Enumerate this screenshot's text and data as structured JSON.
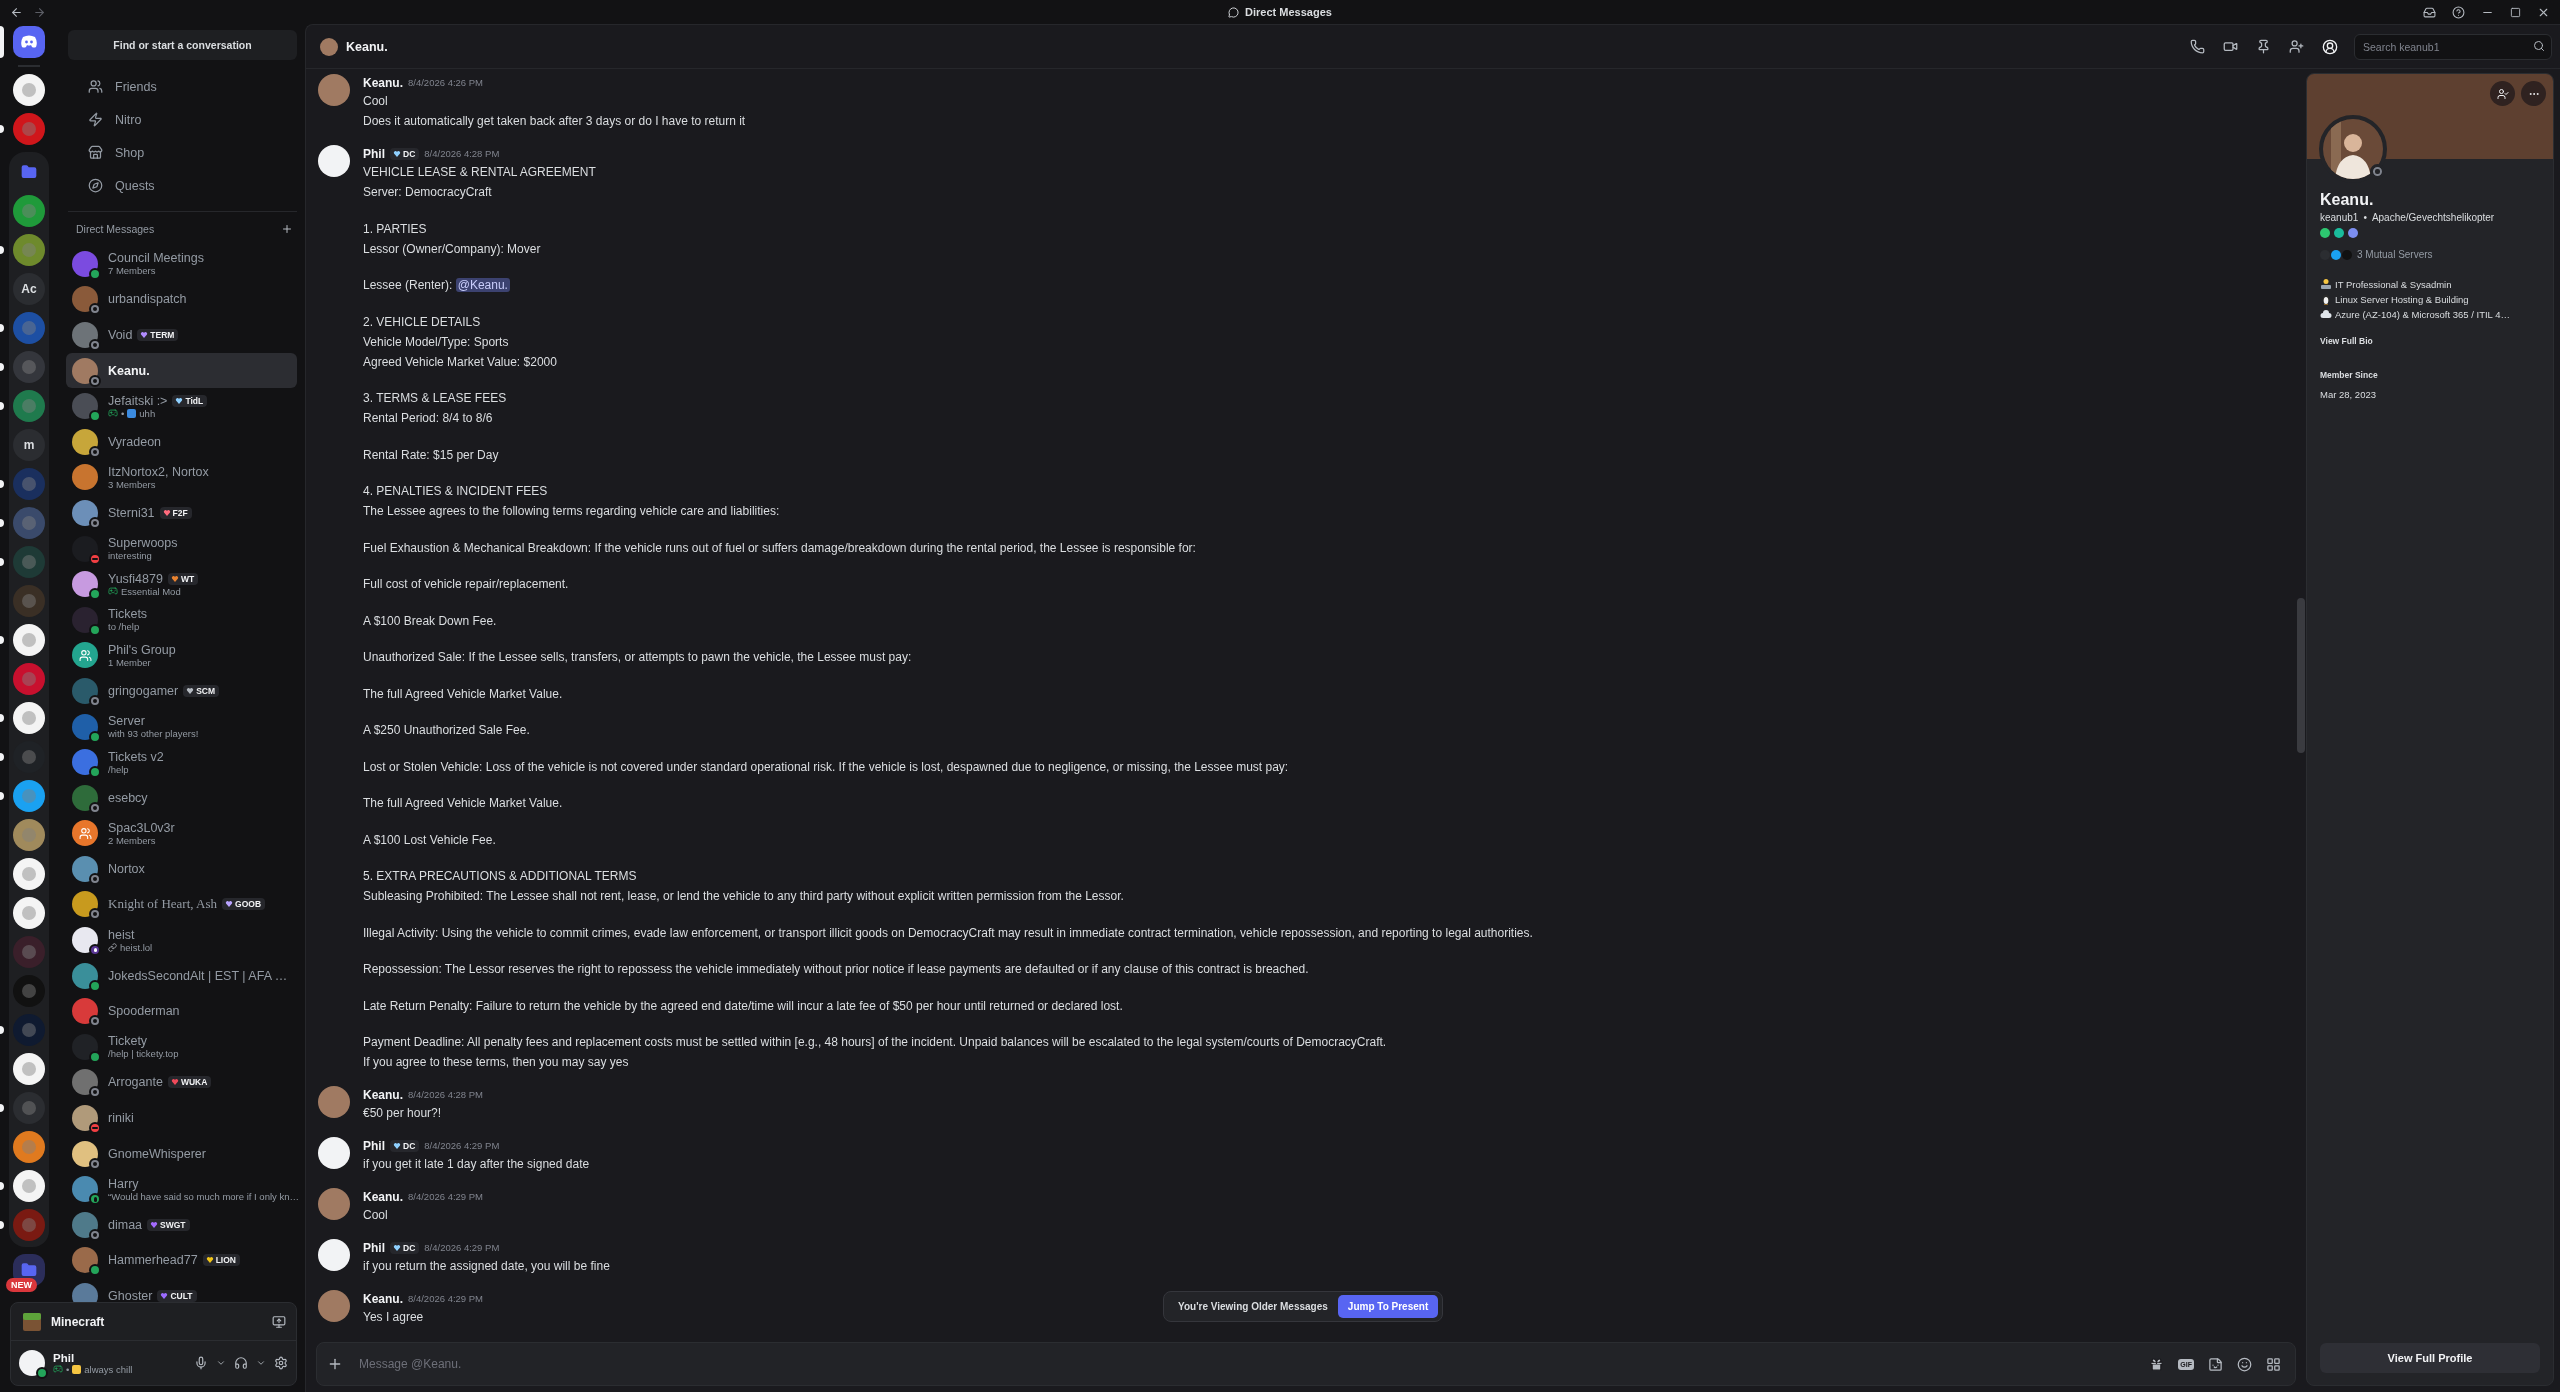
{
  "titlebar": {
    "title": "Direct Messages"
  },
  "rail": [
    {
      "kind": "home",
      "color": "#5865f2",
      "selected": true,
      "unread": false
    },
    {
      "kind": "server",
      "color": "#f4f4f4",
      "selected": false,
      "unread": false
    },
    {
      "kind": "server",
      "color": "#d0161b",
      "selected": false,
      "unread": true
    },
    {
      "kind": "folder",
      "color": "#5865f2",
      "expanded": true,
      "selected": false,
      "unread": false,
      "children": [
        {
          "kind": "server",
          "color": "#1f9a3a",
          "selected": false,
          "unread": false
        },
        {
          "kind": "server",
          "color": "#6e8a2c",
          "selected": false,
          "unread": true
        },
        {
          "kind": "server",
          "label": "Ac",
          "color": "#2b2d31",
          "selected": false,
          "unread": false
        },
        {
          "kind": "server",
          "color": "#1d4fa3",
          "selected": false,
          "unread": true
        },
        {
          "kind": "server",
          "color": "#34363c",
          "selected": false,
          "unread": true
        },
        {
          "kind": "server",
          "color": "#1f7a4d",
          "selected": false,
          "unread": true
        },
        {
          "kind": "server",
          "label": "m",
          "color": "#2b2d31",
          "selected": false,
          "unread": false
        },
        {
          "kind": "server",
          "color": "#1a2f5e",
          "selected": false,
          "unread": true
        },
        {
          "kind": "server",
          "color": "#3a4a6b",
          "selected": false,
          "unread": true
        },
        {
          "kind": "server",
          "color": "#1e3a36",
          "selected": false,
          "unread": true
        },
        {
          "kind": "server",
          "color": "#3a2f25",
          "selected": false,
          "unread": false
        },
        {
          "kind": "server",
          "color": "#f4f4f4",
          "selected": false,
          "unread": true
        },
        {
          "kind": "server",
          "color": "#c8102e",
          "selected": false,
          "unread": false
        },
        {
          "kind": "server",
          "color": "#f4f4f4",
          "selected": false,
          "unread": true
        },
        {
          "kind": "server",
          "color": "#1f2226",
          "selected": false,
          "unread": true
        },
        {
          "kind": "server",
          "color": "#1aa1f1",
          "selected": false,
          "unread": true
        },
        {
          "kind": "server",
          "color": "#a08a5c",
          "selected": false,
          "unread": false
        },
        {
          "kind": "server",
          "color": "#f4f4f4",
          "selected": false,
          "unread": false
        },
        {
          "kind": "server",
          "color": "#f4f4f4",
          "selected": false,
          "unread": false
        },
        {
          "kind": "server",
          "color": "#3a1f2a",
          "selected": false,
          "unread": false
        },
        {
          "kind": "server",
          "color": "#111111",
          "selected": false,
          "unread": false
        },
        {
          "kind": "server",
          "color": "#0f1a30",
          "selected": false,
          "unread": true
        },
        {
          "kind": "server",
          "color": "#f4f4f4",
          "selected": false,
          "unread": false
        },
        {
          "kind": "server",
          "color": "#2b2d31",
          "selected": false,
          "unread": true
        },
        {
          "kind": "server",
          "color": "#e07a1f",
          "selected": false,
          "unread": false
        },
        {
          "kind": "server",
          "color": "#f4f4f4",
          "selected": false,
          "unread": true
        },
        {
          "kind": "server",
          "color": "#7a1a12",
          "selected": false,
          "unread": true
        }
      ]
    },
    {
      "kind": "folder",
      "color": "#5865f2",
      "expanded": false,
      "badge": "NEW",
      "selected": false,
      "unread": false
    }
  ],
  "dm_column": {
    "search": "Find or start a conversation",
    "nav": [
      {
        "label": "Friends"
      },
      {
        "label": "Nitro"
      },
      {
        "label": "Shop"
      },
      {
        "label": "Quests"
      }
    ],
    "heading": "Direct Messages"
  },
  "dms": [
    {
      "name": "Council Meetings",
      "subtitle": {
        "kind": "plain",
        "text": "7 Members"
      },
      "presence": {
        "kind": "dot",
        "color": "#23a55a"
      },
      "avatar": {
        "kind": "plain",
        "color": "#7b4be0"
      },
      "selected": false
    },
    {
      "name": "urbandispatch",
      "presence": {
        "kind": "ring",
        "color": "#80848e"
      },
      "avatar": {
        "kind": "plain",
        "color": "#8a5a3a"
      },
      "selected": false
    },
    {
      "name": "Void",
      "tag": {
        "text": "TERM",
        "color": "#b18cff"
      },
      "presence": {
        "kind": "ring",
        "color": "#80848e"
      },
      "avatar": {
        "kind": "plain",
        "color": "#6d7378"
      },
      "selected": false
    },
    {
      "name": "Keanu.",
      "presence": {
        "kind": "ring",
        "color": "#80848e"
      },
      "avatar": {
        "kind": "plain",
        "color": "#a07a62"
      },
      "selected": true
    },
    {
      "name": "Jefaitski :>",
      "tag": {
        "text": "TidL",
        "color": "#8fd0ff"
      },
      "subtitle": {
        "kind": "game_emoji",
        "separator": "•",
        "text": "uhh"
      },
      "presence": {
        "kind": "dot",
        "color": "#23a55a"
      },
      "avatar": {
        "kind": "plain",
        "color": "#4a4d55"
      },
      "selected": false
    },
    {
      "name": "Vyradeon",
      "presence": {
        "kind": "ring",
        "color": "#80848e"
      },
      "avatar": {
        "kind": "plain",
        "color": "#c7a63a"
      },
      "selected": false
    },
    {
      "name": "ItzNortox2, Nortox",
      "subtitle": {
        "kind": "plain",
        "text": "3 Members"
      },
      "avatar": {
        "kind": "plain",
        "color": "#c8742f"
      },
      "selected": false
    },
    {
      "name": "Sterni31",
      "tag": {
        "text": "F2F",
        "color": "#ff6b7d"
      },
      "presence": {
        "kind": "ring",
        "color": "#80848e"
      },
      "avatar": {
        "kind": "plain",
        "color": "#6c8fb8"
      },
      "selected": false
    },
    {
      "name": "Superwoops",
      "subtitle": {
        "kind": "plain",
        "text": "interesting"
      },
      "presence": {
        "kind": "bar",
        "color": "#f23f43"
      },
      "avatar": {
        "kind": "plain",
        "color": "#1b1c20"
      },
      "selected": false
    },
    {
      "name": "Yusfi4879",
      "tag": {
        "text": "WT",
        "color": "#e8822f"
      },
      "subtitle": {
        "kind": "game",
        "text": "Essential Mod"
      },
      "presence": {
        "kind": "dot",
        "color": "#23a55a"
      },
      "avatar": {
        "kind": "plain",
        "color": "#c79ae0"
      },
      "selected": false
    },
    {
      "name": "Tickets",
      "subtitle": {
        "kind": "plain",
        "text": "to /help"
      },
      "presence": {
        "kind": "dot",
        "color": "#23a55a"
      },
      "avatar": {
        "kind": "plain",
        "color": "#2a2230"
      },
      "selected": false
    },
    {
      "name": "Phil's Group",
      "subtitle": {
        "kind": "plain",
        "text": "1 Member"
      },
      "avatar": {
        "kind": "group",
        "color": "#23a58f"
      },
      "selected": false
    },
    {
      "name": "gringogamer",
      "tag": {
        "text": "SCM",
        "color": "#b5bac1"
      },
      "presence": {
        "kind": "ring",
        "color": "#80848e"
      },
      "avatar": {
        "kind": "plain",
        "color": "#2a5a6a"
      },
      "selected": false
    },
    {
      "name": "Server",
      "subtitle": {
        "kind": "plain",
        "text": "with 93 other players!"
      },
      "presence": {
        "kind": "dot",
        "color": "#23a55a"
      },
      "avatar": {
        "kind": "plain",
        "color": "#1f5fa8"
      },
      "selected": false
    },
    {
      "name": "Tickets v2",
      "subtitle": {
        "kind": "plain",
        "text": "/help"
      },
      "presence": {
        "kind": "dot",
        "color": "#23a55a"
      },
      "avatar": {
        "kind": "plain",
        "color": "#3b6fe0"
      },
      "selected": false
    },
    {
      "name": "esebcy",
      "presence": {
        "kind": "ring",
        "color": "#80848e"
      },
      "avatar": {
        "kind": "plain",
        "color": "#2e6b3a"
      },
      "selected": false
    },
    {
      "name": "Spac3L0v3r",
      "subtitle": {
        "kind": "plain",
        "text": "2 Members"
      },
      "avatar": {
        "kind": "group",
        "color": "#e8762b"
      },
      "selected": false
    },
    {
      "name": "Nortox",
      "presence": {
        "kind": "ring",
        "color": "#80848e"
      },
      "avatar": {
        "kind": "plain",
        "color": "#5a8fb0"
      },
      "selected": false
    },
    {
      "name": "Knight of Heart, Ash",
      "fancy_name": true,
      "tag": {
        "text": "GOOB",
        "color": "#b9a3ff"
      },
      "presence": {
        "kind": "ring",
        "color": "#80848e"
      },
      "avatar": {
        "kind": "plain",
        "color": "#c89a1e"
      },
      "selected": false
    },
    {
      "name": "heist",
      "subtitle": {
        "kind": "link",
        "text": "heist.lol"
      },
      "presence": {
        "kind": "play",
        "color": "#593695"
      },
      "avatar": {
        "kind": "plain",
        "color": "#e8e8f0"
      },
      "selected": false
    },
    {
      "name": "JokedsSecondAlt | EST | AFA …",
      "presence": {
        "kind": "dot",
        "color": "#23a55a"
      },
      "avatar": {
        "kind": "plain",
        "color": "#3a8f9a"
      },
      "selected": false
    },
    {
      "name": "Spooderman",
      "presence": {
        "kind": "ring",
        "color": "#80848e"
      },
      "avatar": {
        "kind": "plain",
        "color": "#d83a3a"
      },
      "selected": false
    },
    {
      "name": "Tickety",
      "subtitle": {
        "kind": "plain",
        "text": "/help | tickety.top"
      },
      "presence": {
        "kind": "dot",
        "color": "#23a55a"
      },
      "avatar": {
        "kind": "plain",
        "color": "#202226"
      },
      "selected": false
    },
    {
      "name": "Arrogante",
      "tag": {
        "text": "WUKA",
        "color": "#f04a5a"
      },
      "presence": {
        "kind": "ring",
        "color": "#80848e"
      },
      "avatar": {
        "kind": "plain",
        "color": "#707070"
      },
      "selected": false
    },
    {
      "name": "riniki",
      "presence": {
        "kind": "bar",
        "color": "#f23f43"
      },
      "avatar": {
        "kind": "plain",
        "color": "#b09a7a"
      },
      "selected": false
    },
    {
      "name": "GnomeWhisperer",
      "presence": {
        "kind": "ring",
        "color": "#80848e"
      },
      "avatar": {
        "kind": "plain",
        "color": "#e0c080"
      },
      "selected": false
    },
    {
      "name": "Harry",
      "subtitle": {
        "kind": "plain",
        "text": "“Would have said so much more if I only kn…"
      },
      "presence": {
        "kind": "phone",
        "color": "#23a55a"
      },
      "avatar": {
        "kind": "plain",
        "color": "#4a8ab0"
      },
      "selected": false
    },
    {
      "name": "dimaa",
      "tag": {
        "text": "SWGT",
        "color": "#a46bff"
      },
      "presence": {
        "kind": "ring",
        "color": "#80848e"
      },
      "avatar": {
        "kind": "plain",
        "color": "#4f7a8a"
      },
      "selected": false
    },
    {
      "name": "Hammerhead77",
      "tag": {
        "text": "LION",
        "color": "#f0c419"
      },
      "presence": {
        "kind": "dot",
        "color": "#23a55a"
      },
      "avatar": {
        "kind": "plain",
        "color": "#9a6a4a"
      },
      "selected": false
    },
    {
      "name": "Ghoster",
      "tag": {
        "text": "CULT",
        "color": "#9b6bff"
      },
      "avatar": {
        "kind": "plain",
        "color": "#5a7a9a"
      },
      "selected": false
    }
  ],
  "user_panel": {
    "activity": "Minecraft",
    "user": "Phil",
    "separator": "•",
    "custom_status": "always chill",
    "presence": {
      "kind": "dot",
      "color": "#23a55a"
    }
  },
  "chat_header": {
    "name": "Keanu.",
    "search_placeholder": "Search keanub1",
    "profile_panel_open": true
  },
  "messages": [
    {
      "author": "Keanu.",
      "avatar": {
        "color": "#a07a62"
      },
      "time": "8/4/2026 4:26 PM",
      "paragraphs": [
        [
          "Cool",
          "Does it automatically get taken back after 3 days or do I have to return it"
        ]
      ]
    },
    {
      "author": "Phil",
      "avatar": {
        "color": "#f2f3f5"
      },
      "tag": {
        "text": "DC",
        "color": "#8fd0ff"
      },
      "time": "8/4/2026 4:28 PM",
      "paragraphs": [
        [
          "VEHICLE LEASE & RENTAL AGREEMENT",
          "Server: DemocracyCraft"
        ],
        [
          "1. PARTIES",
          "Lessor (Owner/Company): Mover"
        ],
        [
          {
            "text": "Lessee (Renter): ",
            "mention": "@Keanu."
          }
        ],
        [
          "2. VEHICLE DETAILS",
          "Vehicle Model/Type: Sports",
          "Agreed Vehicle Market Value: $2000"
        ],
        [
          "3. TERMS & LEASE FEES",
          "Rental Period: 8/4 to 8/6"
        ],
        [
          "Rental Rate: $15 per Day"
        ],
        [
          "4. PENALTIES & INCIDENT FEES",
          "The Lessee agrees to the following terms regarding vehicle care and liabilities:"
        ],
        [
          "Fuel Exhaustion & Mechanical Breakdown: If the vehicle runs out of fuel or suffers damage/breakdown during the rental period, the Lessee is responsible for:"
        ],
        [
          "Full cost of vehicle repair/replacement."
        ],
        [
          "A $100 Break Down Fee."
        ],
        [
          "Unauthorized Sale: If the Lessee sells, transfers, or attempts to pawn the vehicle, the Lessee must pay:"
        ],
        [
          "The full Agreed Vehicle Market Value."
        ],
        [
          "A $250 Unauthorized Sale Fee."
        ],
        [
          "Lost or Stolen Vehicle: Loss of the vehicle is not covered under standard operational risk. If the vehicle is lost, despawned due to negligence, or missing, the Lessee must pay:"
        ],
        [
          "The full Agreed Vehicle Market Value."
        ],
        [
          "A $100 Lost Vehicle Fee."
        ],
        [
          "5. EXTRA PRECAUTIONS & ADDITIONAL TERMS",
          "Subleasing Prohibited: The Lessee shall not rent, lease, or lend the vehicle to any third party without explicit written permission from the Lessor."
        ],
        [
          "Illegal Activity: Using the vehicle to commit crimes, evade law enforcement, or transport illicit goods on DemocracyCraft may result in immediate contract termination, vehicle repossession, and reporting to legal authorities."
        ],
        [
          "Repossession: The Lessor reserves the right to repossess the vehicle immediately without prior notice if lease payments are defaulted or if any clause of this contract is breached."
        ],
        [
          "Late Return Penalty: Failure to return the vehicle by the agreed end date/time will incur a late fee of $50 per hour until returned or declared lost."
        ],
        [
          "Payment Deadline: All penalty fees and replacement costs must be settled within [e.g., 48 hours] of the incident. Unpaid balances will be escalated to the legal system/courts of DemocracyCraft.",
          "If you agree to these terms, then you may say yes"
        ]
      ]
    },
    {
      "author": "Keanu.",
      "avatar": {
        "color": "#a07a62"
      },
      "time": "8/4/2026 4:28 PM",
      "paragraphs": [
        [
          "€50 per hour?!"
        ]
      ]
    },
    {
      "author": "Phil",
      "avatar": {
        "color": "#f2f3f5"
      },
      "tag": {
        "text": "DC",
        "color": "#8fd0ff"
      },
      "time": "8/4/2026 4:29 PM",
      "paragraphs": [
        [
          "if you get it late 1 day after the signed date"
        ]
      ]
    },
    {
      "author": "Keanu.",
      "avatar": {
        "color": "#a07a62"
      },
      "time": "8/4/2026 4:29 PM",
      "paragraphs": [
        [
          "Cool"
        ]
      ]
    },
    {
      "author": "Phil",
      "avatar": {
        "color": "#f2f3f5"
      },
      "tag": {
        "text": "DC",
        "color": "#8fd0ff"
      },
      "time": "8/4/2026 4:29 PM",
      "paragraphs": [
        [
          "if you return the assigned date, you will be fine"
        ]
      ]
    },
    {
      "author": "Keanu.",
      "avatar": {
        "color": "#a07a62"
      },
      "time": "8/4/2026 4:29 PM",
      "paragraphs": [
        [
          "Yes I agree"
        ]
      ]
    }
  ],
  "jump_bar": {
    "text": "You're Viewing Older Messages",
    "button": "Jump To Present"
  },
  "composer": {
    "placeholder": "Message @Keanu.",
    "gif_label": "GIF"
  },
  "profile": {
    "display_name": "Keanu.",
    "username": "keanub1",
    "separator": "•",
    "pronouns": "Apache/Gevechtshelikopter",
    "presence": {
      "kind": "ring",
      "color": "#80848e"
    },
    "badges": [
      {
        "color": "#2dc770"
      },
      {
        "color": "#1abc9c"
      },
      {
        "color": "#7c8ef0"
      }
    ],
    "mutual_icons": [
      {
        "color": "#2b2d31"
      },
      {
        "color": "#1aa1f1"
      },
      {
        "color": "#111111"
      }
    ],
    "mutual_servers": "3 Mutual Servers",
    "bio": [
      "IT Professional & Sysadmin",
      "Linux Server Hosting & Building",
      "Azure (AZ-104) & Microsoft 365 / ITIL 4…"
    ],
    "view_bio": "View Full Bio",
    "member_since_label": "Member Since",
    "member_since": "Mar 28, 2023",
    "button": "View Full Profile"
  }
}
